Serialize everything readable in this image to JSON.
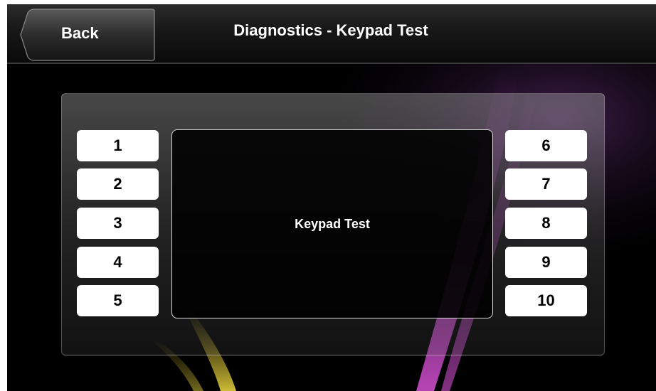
{
  "header": {
    "back_label": "Back",
    "title": "Diagnostics - Keypad Test"
  },
  "keypad": {
    "left_keys": [
      "1",
      "2",
      "3",
      "4",
      "5"
    ],
    "right_keys": [
      "6",
      "7",
      "8",
      "9",
      "10"
    ],
    "display_label": "Keypad Test"
  },
  "colors": {
    "background": "#000000",
    "key_fill": "#ffffff",
    "glow_pink": "#d24bd8",
    "glow_yellow": "#e6d23a"
  }
}
